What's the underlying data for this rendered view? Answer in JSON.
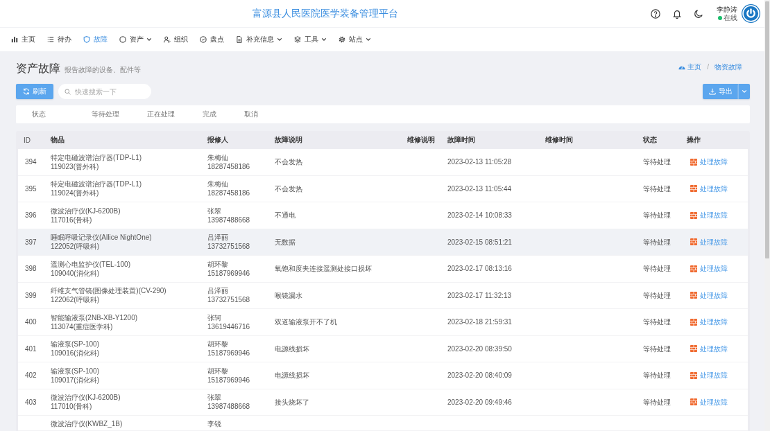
{
  "header": {
    "title": "富源县人民医院医学装备管理平台",
    "user": {
      "name": "李静涛",
      "status": "在线",
      "online": true
    }
  },
  "nav": [
    {
      "label": "主页",
      "dropdown": false,
      "selected": false
    },
    {
      "label": "待办",
      "dropdown": false,
      "selected": false
    },
    {
      "label": "故障",
      "dropdown": false,
      "selected": true
    },
    {
      "label": "资产",
      "dropdown": true,
      "selected": false
    },
    {
      "label": "组织",
      "dropdown": false,
      "selected": false
    },
    {
      "label": "盘点",
      "dropdown": false,
      "selected": false
    },
    {
      "label": "补充信息",
      "dropdown": true,
      "selected": false
    },
    {
      "label": "工具",
      "dropdown": true,
      "selected": false
    },
    {
      "label": "站点",
      "dropdown": true,
      "selected": false
    }
  ],
  "page": {
    "title": "资产故障",
    "subtitle": "报告故障的设备、配件等"
  },
  "breadcrumb": {
    "separator": "/",
    "items": [
      {
        "label": "主页"
      },
      {
        "label": "物资故障"
      }
    ]
  },
  "toolbar": {
    "refresh_label": "刷新",
    "search_placeholder": "快速搜索一下",
    "export_label": "导出"
  },
  "filters": {
    "label": "状态",
    "options": [
      "等待处理",
      "正在处理",
      "完成",
      "取消"
    ]
  },
  "table": {
    "columns": [
      "ID",
      "物品",
      "报修人",
      "故障说明",
      "维修说明",
      "故障时间",
      "维修时间",
      "状态",
      "操作"
    ],
    "rows": [
      {
        "id": "394",
        "item": "特定电磁波谱治疗器(TDP-L1)",
        "item_code": "119023(普外科)",
        "reporter": "朱梅仙",
        "phone": "18287458186",
        "description": "不会发热",
        "fault_time": "2023-02-13 11:05:28",
        "status": "等待处理",
        "action": "处理故障",
        "highlighted": false
      },
      {
        "id": "395",
        "item": "特定电磁波谱治疗器(TDP-L1)",
        "item_code": "119024(普外科)",
        "reporter": "朱梅仙",
        "phone": "18287458186",
        "description": "不会发热",
        "fault_time": "2023-02-13 11:05:44",
        "status": "等待处理",
        "action": "处理故障",
        "highlighted": false
      },
      {
        "id": "396",
        "item": "微波治疗仪(KJ-6200B)",
        "item_code": "117016(骨科)",
        "reporter": "张翠",
        "phone": "13987488668",
        "description": "不通电",
        "fault_time": "2023-02-14 10:08:33",
        "status": "等待处理",
        "action": "处理故障",
        "highlighted": false
      },
      {
        "id": "397",
        "item": "睡眠呼吸记录仪(Allice NightOne)",
        "item_code": "122052(呼吸科)",
        "reporter": "吕泽丽",
        "phone": "13732751568",
        "description": "无数据",
        "fault_time": "2023-02-15 08:51:21",
        "status": "等待处理",
        "action": "处理故障",
        "highlighted": true
      },
      {
        "id": "398",
        "item": "遥测心电监护仪(TEL-100)",
        "item_code": "109040(消化科)",
        "reporter": "胡环黎",
        "phone": "15187969946",
        "description": "氧饱和度夹连接遥测处接口损坏",
        "fault_time": "2023-02-17 08:13:16",
        "status": "等待处理",
        "action": "处理故障",
        "highlighted": false
      },
      {
        "id": "399",
        "item": "纤维支气管镜(图像处理装置)(CV-290)",
        "item_code": "122062(呼吸科)",
        "reporter": "吕泽丽",
        "phone": "13732751568",
        "description": "喉镜漏水",
        "fault_time": "2023-02-17 11:32:13",
        "status": "等待处理",
        "action": "处理故障",
        "highlighted": false
      },
      {
        "id": "400",
        "item": "智能输液泵(2NB-XB-Y1200)",
        "item_code": "113074(重症医学科)",
        "reporter": "张轲",
        "phone": "13619446716",
        "description": "双道输液泵开不了机",
        "fault_time": "2023-02-18 21:59:31",
        "status": "等待处理",
        "action": "处理故障",
        "highlighted": false
      },
      {
        "id": "401",
        "item": "输液泵(SP-100)",
        "item_code": "109016(消化科)",
        "reporter": "胡环黎",
        "phone": "15187969946",
        "description": "电源线损坏",
        "fault_time": "2023-02-20 08:39:50",
        "status": "等待处理",
        "action": "处理故障",
        "highlighted": false
      },
      {
        "id": "402",
        "item": "输液泵(SP-100)",
        "item_code": "109017(消化科)",
        "reporter": "胡环黎",
        "phone": "15187969946",
        "description": "电源线损坏",
        "fault_time": "2023-02-20 08:40:09",
        "status": "等待处理",
        "action": "处理故障",
        "highlighted": false
      },
      {
        "id": "403",
        "item": "微波治疗仪(KJ-6200B)",
        "item_code": "117010(骨科)",
        "reporter": "张翠",
        "phone": "13987488668",
        "description": "接头烧坏了",
        "fault_time": "2023-02-20 09:49:46",
        "status": "等待处理",
        "action": "处理故障",
        "highlighted": false
      },
      {
        "item": "微波治疗仪(KWBZ_1B)",
        "reporter": "李锐",
        "highlighted": false
      }
    ]
  }
}
